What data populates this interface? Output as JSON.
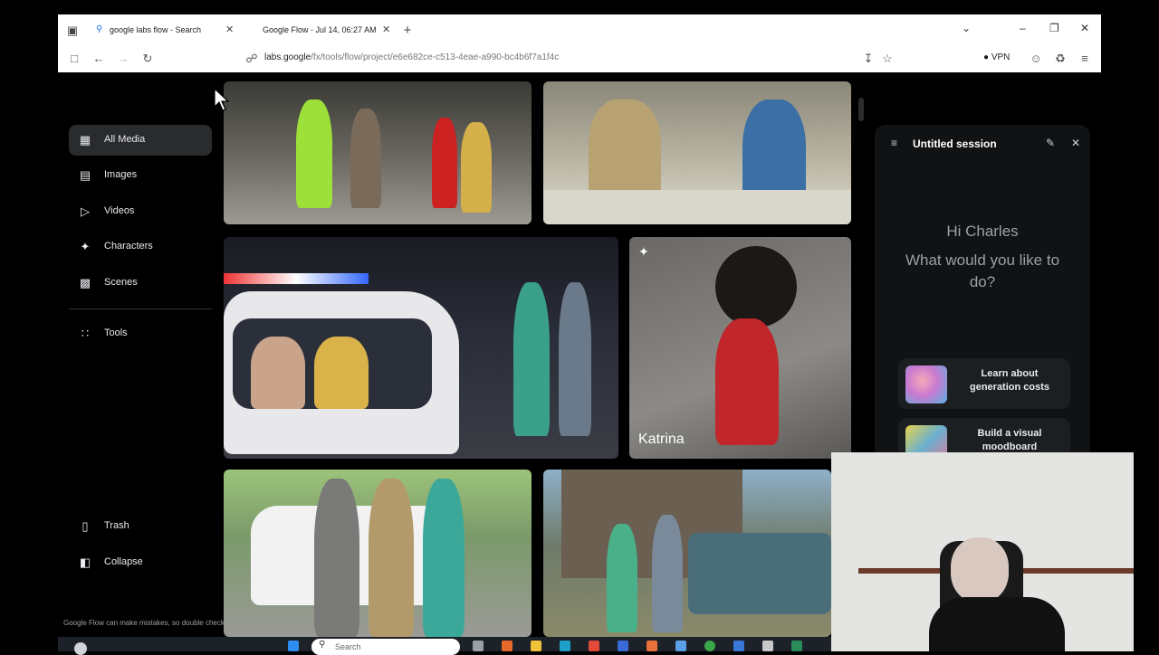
{
  "browser": {
    "tabs": [
      {
        "title": "google labs flow - Search",
        "active": false
      },
      {
        "title": "Google Flow - Jul 14, 06:27 AM",
        "active": true
      }
    ],
    "new_tab": "+",
    "url_host": "labs.google",
    "url_path": "/fx/tools/flow/project/e6e682ce-c513-4eae-a990-bc4b6f7a1f4c",
    "vpn_label": "VPN"
  },
  "sidebar": {
    "items": [
      {
        "label": "All Media",
        "icon": "grid-icon",
        "active": true
      },
      {
        "label": "Images",
        "icon": "image-icon"
      },
      {
        "label": "Videos",
        "icon": "video-icon"
      },
      {
        "label": "Characters",
        "icon": "person-icon"
      },
      {
        "label": "Scenes",
        "icon": "clapperboard-icon"
      },
      {
        "label": "Tools",
        "icon": "tools-icon"
      }
    ],
    "bottom": [
      {
        "label": "Trash",
        "icon": "trash-icon"
      },
      {
        "label": "Collapse",
        "icon": "collapse-icon"
      }
    ],
    "disclaimer": "Google Flow can make mistakes, so double check it"
  },
  "media": {
    "tiles": [
      {
        "name": "media-tile-1",
        "label": ""
      },
      {
        "name": "media-tile-2",
        "label": ""
      },
      {
        "name": "media-tile-3",
        "label": ""
      },
      {
        "name": "media-tile-4",
        "label": "Katrina"
      },
      {
        "name": "media-tile-5",
        "label": ""
      },
      {
        "name": "media-tile-6",
        "label": ""
      }
    ]
  },
  "session": {
    "title": "Untitled session",
    "greeting": "Hi Charles",
    "prompt": "What would you like to do?",
    "cards": [
      {
        "label": "Learn about generation costs"
      },
      {
        "label": "Build a visual moodboard"
      }
    ]
  },
  "taskbar": {
    "search_placeholder": "Search"
  }
}
